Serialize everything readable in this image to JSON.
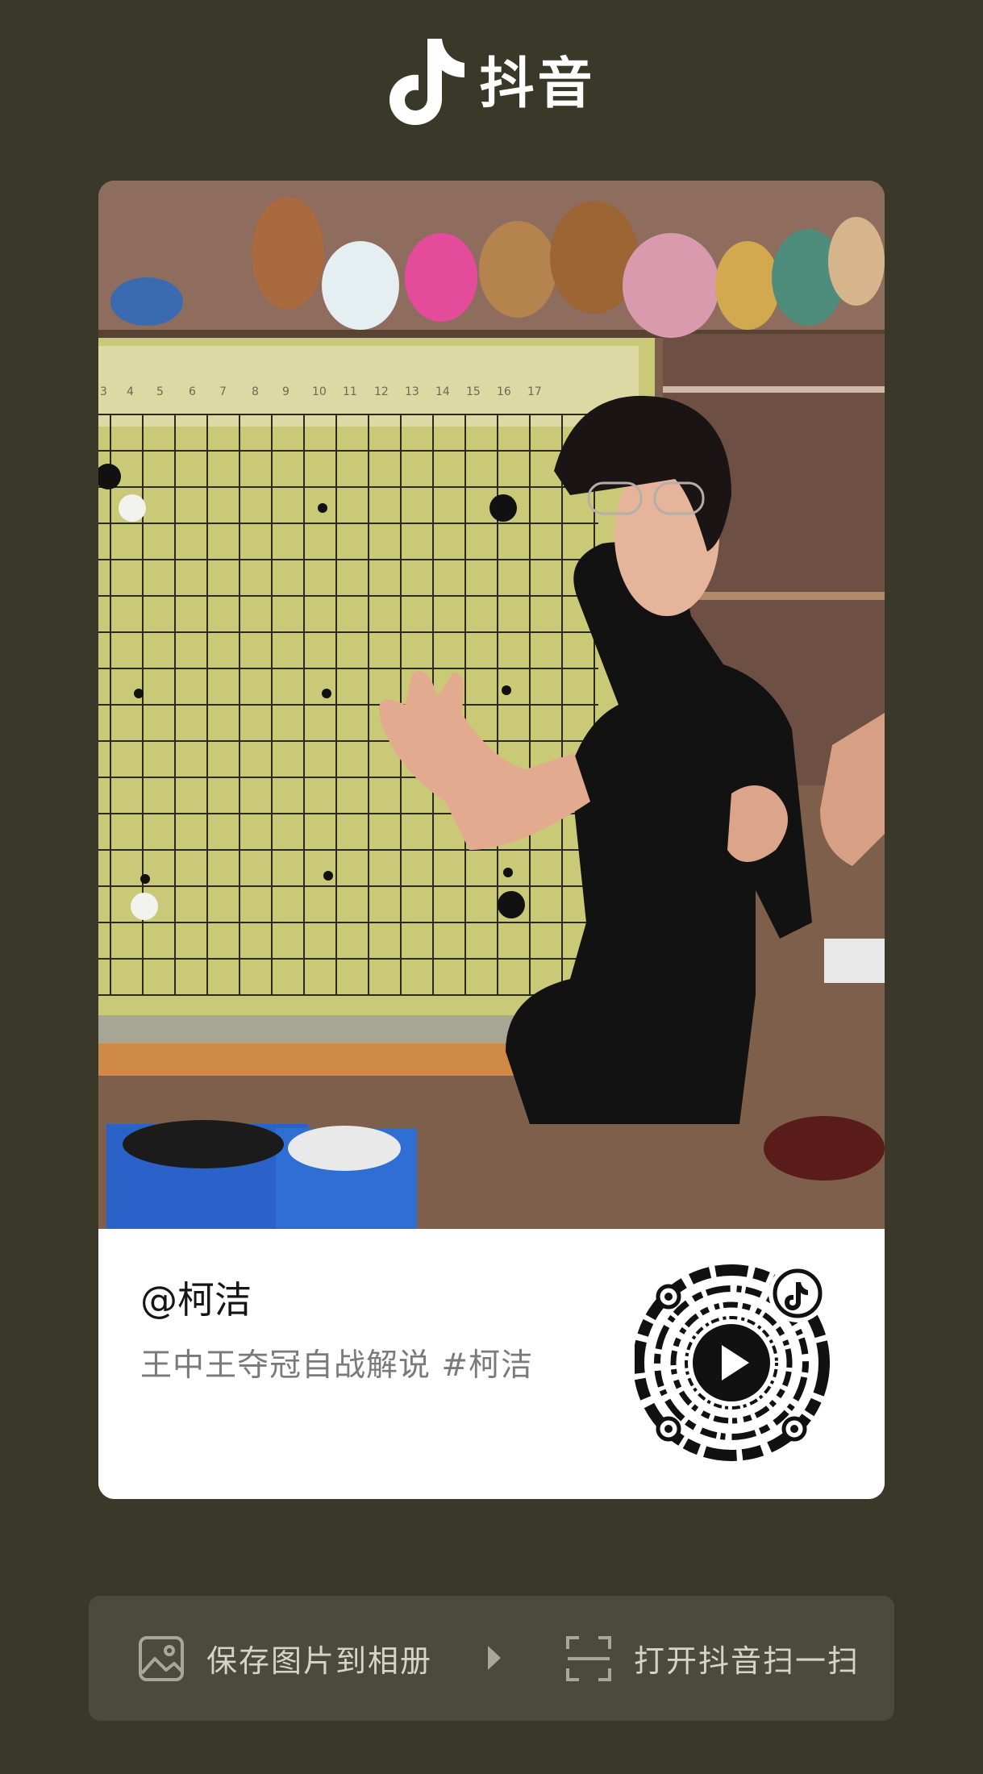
{
  "header": {
    "brand": "抖音",
    "logo_icon": "tiktok-note-icon"
  },
  "video": {
    "image": "man-explaining-go-board-photo",
    "author": "@柯洁",
    "caption": "王中王夺冠自战解说 #柯洁",
    "qr_icon": "douyin-qr-code-icon",
    "board_ruler": [
      "3",
      "4",
      "5",
      "6",
      "7",
      "8",
      "9",
      "10",
      "11",
      "12",
      "13",
      "14",
      "15",
      "16",
      "17"
    ]
  },
  "actions": {
    "save_label": "保存图片到相册",
    "save_icon": "image-icon",
    "next_icon": "play-arrow-icon",
    "scan_label": "打开抖音扫一扫",
    "scan_icon": "scan-frame-icon"
  },
  "colors": {
    "background": "#3a3929",
    "action_bar": "#4b4a3b",
    "card": "#ffffff"
  }
}
